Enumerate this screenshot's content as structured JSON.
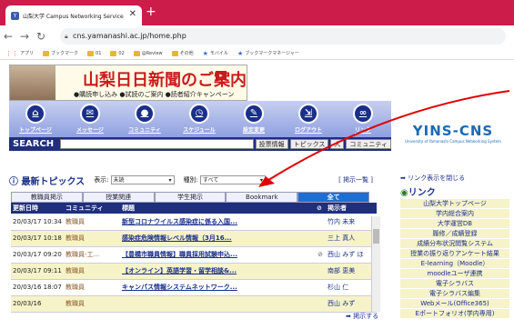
{
  "browser": {
    "tab_title": "山梨大学 Campus Networking Service",
    "url": "cns.yamanashi.ac.jp/home.php",
    "bookmarks": [
      "アプリ",
      "ブックマーク",
      "01",
      "02",
      "@Review",
      "その他",
      "モバイル",
      "ブックマークマネージャー"
    ]
  },
  "banner": {
    "title": "山梨日日新聞のご案内",
    "subtitle": "●購読申し込み ●試読のご案内 ●読者紹介キャンペーン"
  },
  "menu": [
    "トップページ",
    "メッセージ",
    "コミュニティ",
    "スケジュール",
    "設定変更",
    "ログアウト",
    "リンク"
  ],
  "logo": {
    "text": "YINS-CNS",
    "sub": "University of Yamanashi Campus Networking System"
  },
  "search": {
    "label": "SEARCH",
    "buttons": [
      "投票情報",
      "トピックス",
      "人",
      "コミュニティ"
    ]
  },
  "topics": {
    "title": "最新トピックス",
    "display_label": "表示:",
    "display_value": "未読",
    "type_label": "種別:",
    "type_value": "すべて",
    "list_link": "[ 掲示一覧 ]",
    "tabs": [
      "教職員掲示",
      "授業関連",
      "学生掲示",
      "Bookmark",
      "全て"
    ],
    "headers": [
      "更新日時",
      "コミュニティ",
      "標題",
      "",
      "掲示者"
    ],
    "rows": [
      {
        "date": "20/03/17 10:34",
        "cat": "教職員",
        "title": "新型コロナウイルス感染症に係る入国...",
        "clip": "",
        "name": "竹内 未来"
      },
      {
        "date": "20/03/17 10:18",
        "cat": "教職員",
        "title": "感染症危険情報レベル情報（3月16...",
        "clip": "",
        "name": "三上 真人"
      },
      {
        "date": "20/03/17 09:20",
        "cat": "教職員-工...",
        "title": "【豊橋市職員情報】職員採用試験申込...",
        "clip": "⊘",
        "name": "西山 みず ほ"
      },
      {
        "date": "20/03/17 09:11",
        "cat": "教職員",
        "title": "【オンライン】英語学習・留学相談&...",
        "clip": "",
        "name": "南部 恵美"
      },
      {
        "date": "20/03/16 18:07",
        "cat": "教職員",
        "title": "キャンパス情報システムネットワーク...",
        "clip": "",
        "name": "杉山 仁"
      },
      {
        "date": "20/03/16",
        "cat": "教職員",
        "title": "",
        "clip": "",
        "name": "西山 みず"
      }
    ],
    "more": "➡ 掲示する"
  },
  "links": {
    "close": "➡ リンク表示を閉じる",
    "title": "リンク",
    "items": [
      "山梨大学トップページ",
      "学内総合案内",
      "大学運営DB",
      "履修／成績登録",
      "成績分布状況閲覧システム",
      "授業の振り返りアンケート結果",
      "E-learning（Moodle）",
      "moodleユーザ連携",
      "電子シラバス",
      "電子シラバス編集",
      "Webメール(Office365)",
      "Eポートフォリオ(学内専用)"
    ]
  },
  "colors": {
    "tabbar": "#cc1c4a",
    "nav": "#1f2f7d",
    "accent": "#1f6fd0"
  }
}
